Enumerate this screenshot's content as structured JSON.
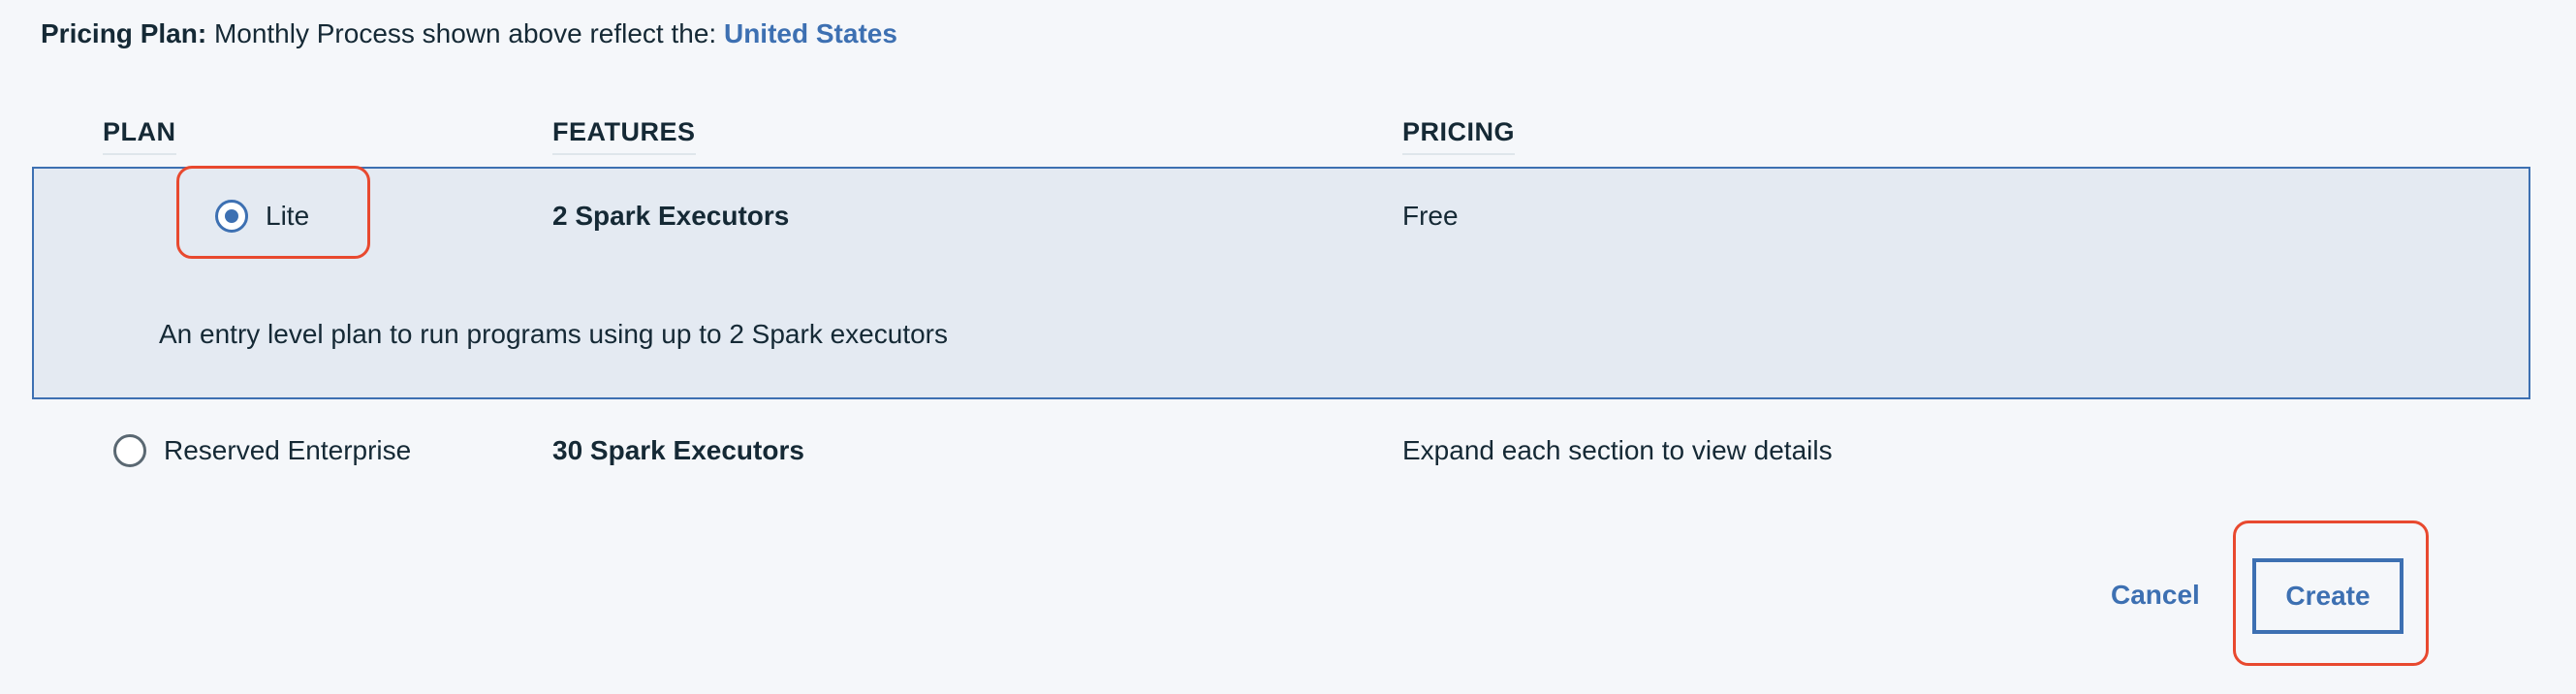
{
  "pricing_plan": {
    "label": "Pricing Plan:",
    "text": "Monthly Process shown above reflect the:",
    "region": "United States"
  },
  "table": {
    "headers": {
      "plan": "PLAN",
      "features": "FEATURES",
      "pricing": "PRICING"
    },
    "plans": [
      {
        "name": "Lite",
        "selected": true,
        "features": "2 Spark Executors",
        "pricing": "Free",
        "description": "An entry level plan to run programs using up to 2 Spark executors"
      },
      {
        "name": "Reserved Enterprise",
        "selected": false,
        "features": "30 Spark Executors",
        "pricing": "Expand each section to view details"
      }
    ]
  },
  "actions": {
    "cancel_label": "Cancel",
    "create_label": "Create"
  },
  "colors": {
    "accent": "#3d70b2",
    "highlight": "#e8492f",
    "selected_row_bg": "#e4eaf2",
    "text": "#152935"
  }
}
